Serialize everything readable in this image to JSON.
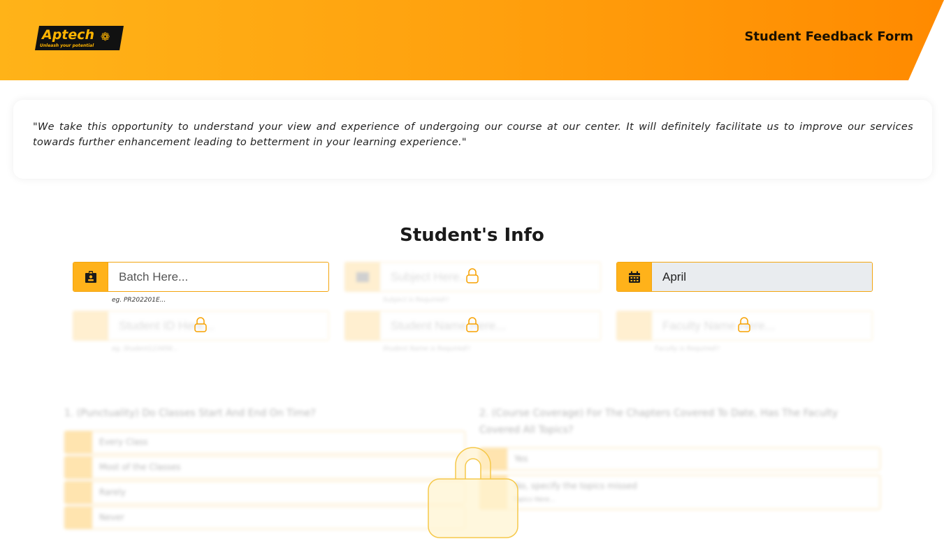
{
  "header": {
    "logo_text": "Aptech",
    "logo_tagline": "Unleash your potential",
    "title": "Student Feedback Form"
  },
  "intro": {
    "quote": "\"We take this opportunity to understand your view and experience of undergoing our course at our center. It will definitely facilitate us to improve our services towards further enhancement leading to betterment in your learning experience.\""
  },
  "student_info": {
    "title": "Student's Info",
    "batch": {
      "placeholder": "Batch Here...",
      "hint": "eg. PR202201E..."
    },
    "subject": {
      "placeholder": "Subject Here...",
      "hint": "Subject is Required!!"
    },
    "month": {
      "value": "April"
    },
    "student_id": {
      "placeholder": "Student ID Here...",
      "hint": "eg. Student123456..."
    },
    "student_name": {
      "placeholder": "Student Name Here...",
      "hint": "Student Name is Required!!"
    },
    "faculty_name": {
      "placeholder": "Faculty Name Here...",
      "hint": "Faculty is Required!!"
    }
  },
  "questions": [
    {
      "text": "1. (Punctuality) Do Classes Start And End On Time?",
      "options": [
        "Every Class",
        "Most of the Classes",
        "Rarely",
        "Never"
      ]
    },
    {
      "text": "2. (Course Coverage) For The Chapters Covered To Date, Has The Faculty Covered All Topics?",
      "options": [
        "Yes",
        "No, specify the topics missed"
      ],
      "input_placeholder": "Topics Here..."
    }
  ],
  "colors": {
    "accent": "#ffb21a",
    "border": "#f3a50f",
    "header_start": "#ffb318",
    "header_end": "#ff8a00"
  }
}
